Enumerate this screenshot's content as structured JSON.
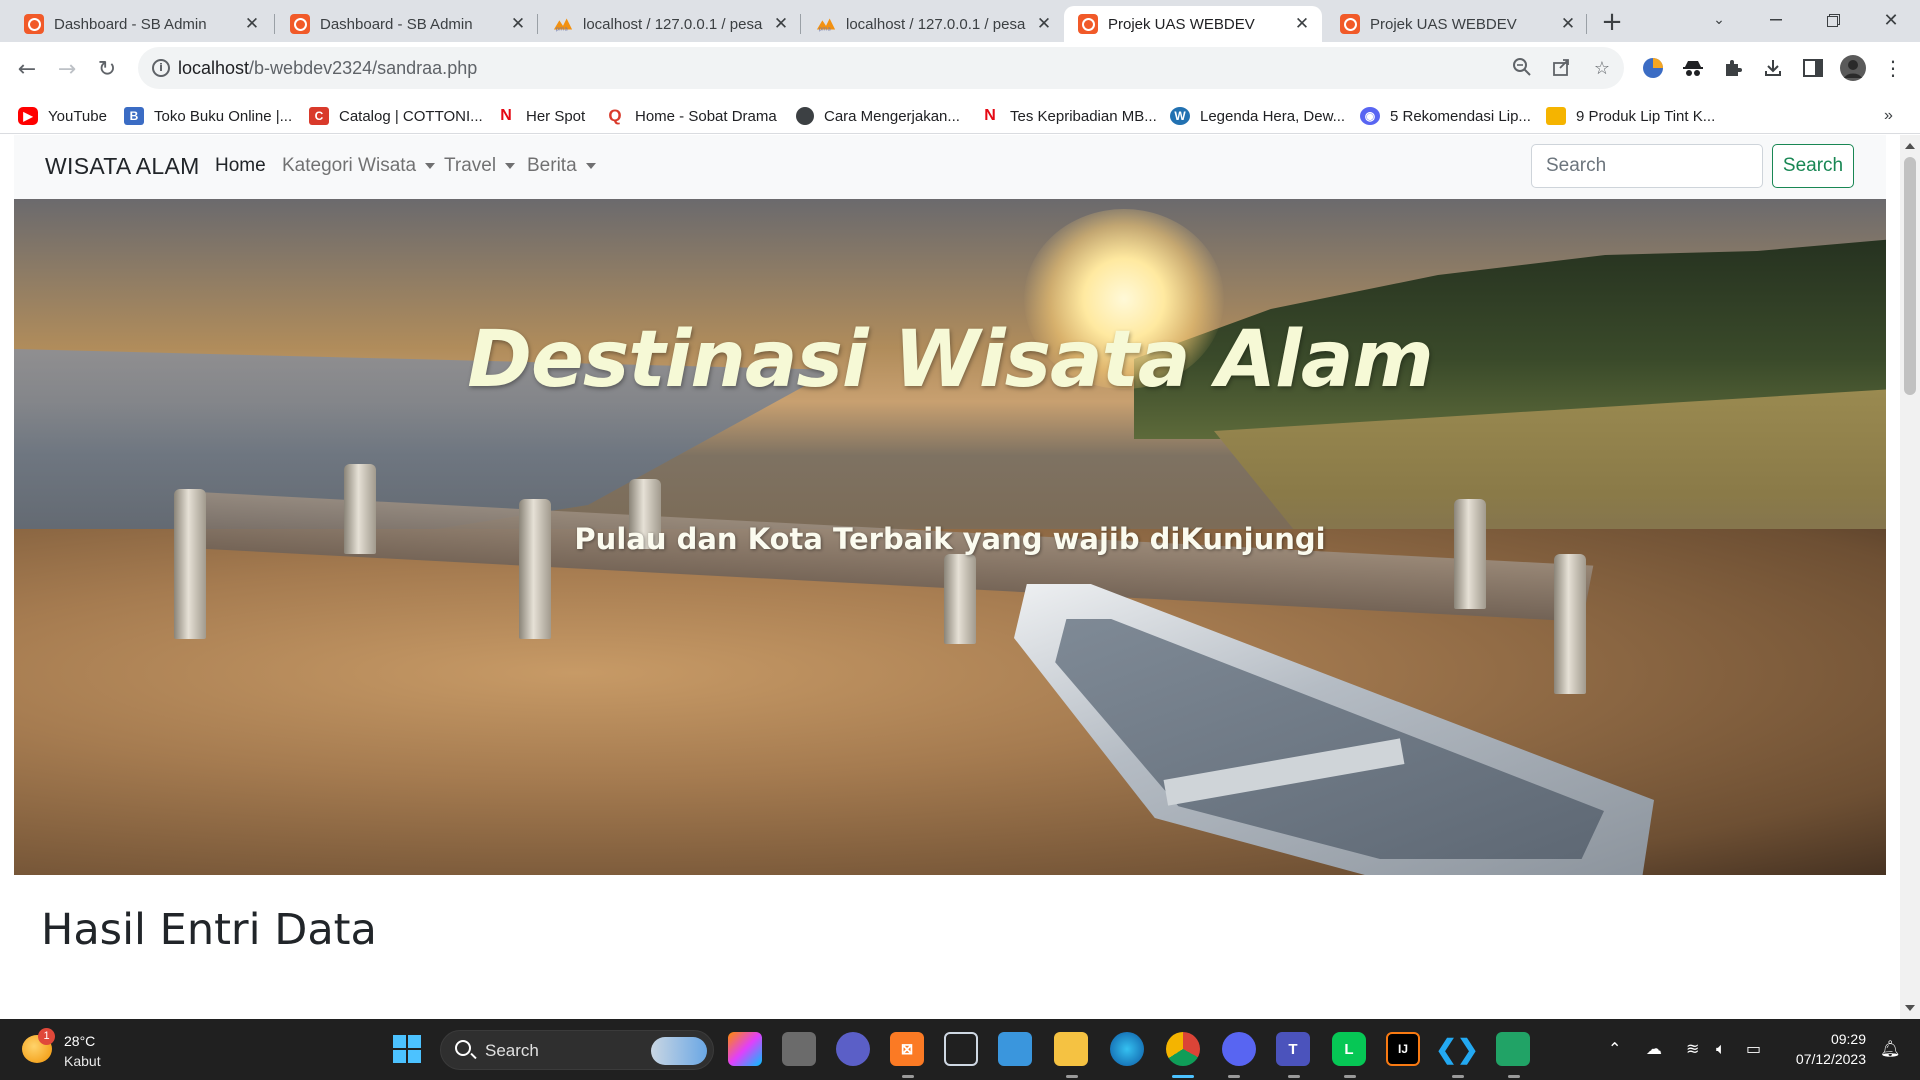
{
  "browser": {
    "tabs": [
      {
        "title": "Dashboard - SB Admin",
        "favicon": "codeigniter-icon",
        "active": false
      },
      {
        "title": "Dashboard - SB Admin",
        "favicon": "codeigniter-icon",
        "active": false
      },
      {
        "title": "localhost / 127.0.0.1 / pesa",
        "favicon": "phpmyadmin-icon",
        "active": false
      },
      {
        "title": "localhost / 127.0.0.1 / pesa",
        "favicon": "phpmyadmin-icon",
        "active": false
      },
      {
        "title": "Projek UAS WEBDEV",
        "favicon": "codeigniter-icon",
        "active": true
      },
      {
        "title": "Projek UAS WEBDEV",
        "favicon": "codeigniter-icon",
        "active": false
      }
    ],
    "url_host": "localhost",
    "url_path": "/b-webdev2324/sandraa.php",
    "bookmarks": [
      {
        "label": "YouTube",
        "icon": "youtube-icon",
        "color": "#ff0000"
      },
      {
        "label": "Toko Buku Online |...",
        "icon": "bookstore-icon",
        "color": "#3b6cc4"
      },
      {
        "label": "Catalog | COTTONI...",
        "icon": "catalog-icon",
        "color": "#d93a2b"
      },
      {
        "label": "Her Spot",
        "icon": "netflix-icon",
        "color": "#e50914"
      },
      {
        "label": "Home - Sobat Drama",
        "icon": "q-icon",
        "color": "#d93a2b"
      },
      {
        "label": "Cara Mengerjakan...",
        "icon": "globe-icon",
        "color": "#3c4043"
      },
      {
        "label": "Tes Kepribadian MB...",
        "icon": "netflix-icon",
        "color": "#e50914"
      },
      {
        "label": "Legenda Hera, Dew...",
        "icon": "wordpress-icon",
        "color": "#2271b1"
      },
      {
        "label": "5 Rekomendasi Lip...",
        "icon": "discord-icon",
        "color": "#5865f2"
      },
      {
        "label": "9 Produk Lip Tint K...",
        "icon": "folder-icon",
        "color": "#f5b400"
      }
    ]
  },
  "site": {
    "brand": "WISATA ALAM",
    "nav": {
      "home": "Home",
      "kategori": "Kategori Wisata",
      "travel": "Travel",
      "berita": "Berita"
    },
    "search_placeholder": "Search",
    "search_button": "Search",
    "hero_title": "Destinasi Wisata Alam",
    "hero_subtitle": "Pulau dan Kota Terbaik yang wajib diKunjungi",
    "section_title": "Hasil Entri Data"
  },
  "taskbar": {
    "weather_temp": "28°C",
    "weather_cond": "Kabut",
    "weather_badge": "1",
    "search_label": "Search",
    "time": "09:29",
    "date": "07/12/2023"
  }
}
